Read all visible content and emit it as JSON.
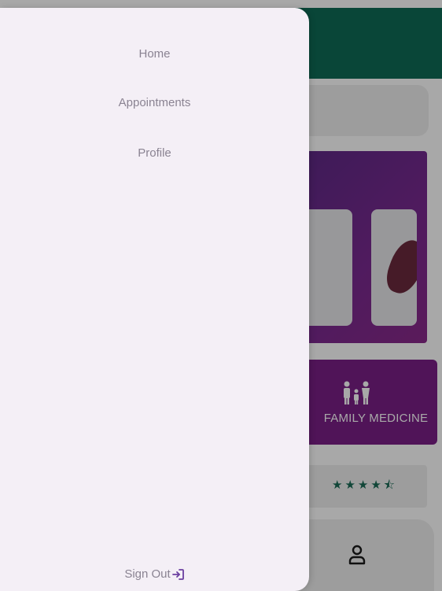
{
  "drawer": {
    "items": [
      {
        "label": "Home"
      },
      {
        "label": "Appointments"
      },
      {
        "label": "Profile"
      }
    ],
    "sign_out_label": "Sign Out",
    "sign_out_icon": "login-icon"
  },
  "background": {
    "specialty": {
      "label": "FAMILY MEDICINE",
      "icon": "family-icon"
    },
    "rating": {
      "value": 4.5,
      "max": 5,
      "stars_text": "★★★★⯪"
    },
    "bottom_nav": {
      "icon": "person-icon"
    }
  },
  "colors": {
    "app_bar": "#0f6b56",
    "specialty_card": "#7a1f86",
    "drawer_background": "#f4eff6",
    "drawer_text": "#8a8392",
    "sign_out_icon": "#6b3fa0",
    "rating_stars": "#1a6b56"
  }
}
